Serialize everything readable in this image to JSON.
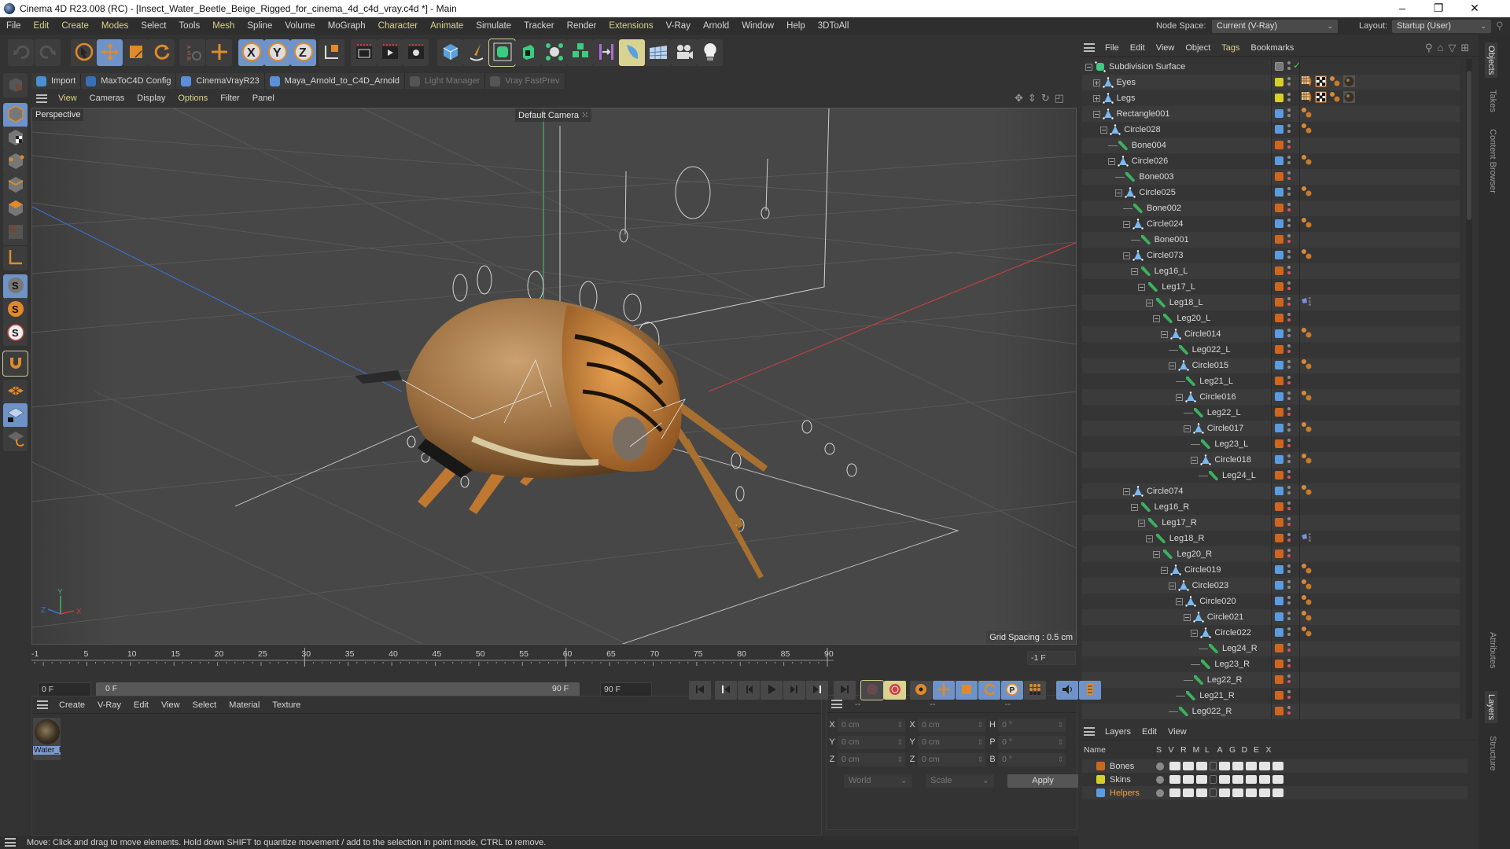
{
  "window": {
    "title": "Cinema 4D R23.008 (RC) - [Insect_Water_Beetle_Beige_Rigged_for_cinema_4d_c4d_vray.c4d *] - Main",
    "controls": [
      "minimize-icon",
      "restore-icon",
      "close-icon"
    ]
  },
  "menubar": {
    "items": [
      "File",
      "Edit",
      "Create",
      "Modes",
      "Select",
      "Tools",
      "Mesh",
      "Spline",
      "Volume",
      "MoGraph",
      "Character",
      "Animate",
      "Simulate",
      "Tracker",
      "Render",
      "Extensions",
      "V-Ray",
      "Arnold",
      "Window",
      "Help",
      "3DToAll"
    ],
    "highlighted": [
      "Edit",
      "Create",
      "Modes",
      "Mesh",
      "Character",
      "Animate",
      "Extensions"
    ],
    "node_space_label": "Node Space:",
    "node_space_value": "Current (V-Ray)",
    "layout_label": "Layout:",
    "layout_value": "Startup (User)"
  },
  "toolbar": {
    "tools": [
      "undo-icon",
      "redo-icon",
      "live-selection-icon",
      "move-icon",
      "scale-icon",
      "rotate-icon",
      "psr-icon",
      "add-transform-icon",
      "x-axis-lock-icon",
      "y-axis-lock-icon",
      "z-axis-lock-icon",
      "coordinate-system-icon",
      "render-view-icon",
      "render-picture-viewer-icon",
      "render-settings-icon",
      "cube-icon",
      "pen-spline-icon",
      "subdivision-surface-icon",
      "extrude-icon",
      "mograph-cloner-icon",
      "array-icon",
      "symmetry-icon",
      "deformer-icon",
      "floor-icon",
      "camera-icon",
      "light-icon"
    ]
  },
  "plugin_bar": {
    "items": [
      {
        "label": "Import",
        "enabled": true
      },
      {
        "label": "MaxToC4D Config",
        "enabled": true
      },
      {
        "label": "CinemaVrayR23",
        "enabled": true
      },
      {
        "label": "Maya_Arnold_to_C4D_Arnold",
        "enabled": true
      },
      {
        "label": "Light Manager",
        "enabled": false
      },
      {
        "label": "Vray FastPrev",
        "enabled": false
      }
    ]
  },
  "left_palette": {
    "tools": [
      "make-editable-icon",
      "model-mode-icon",
      "texture-mode-icon",
      "point-mode-icon",
      "edge-mode-icon",
      "polygon-mode-icon",
      "uv-mode-icon",
      "axis-mode-icon",
      "snap-icon",
      "snap-settings-icon",
      "snap-enable-icon",
      "magnet-icon",
      "workplane-icon",
      "locked-workplane-icon",
      "workplane-align-icon"
    ]
  },
  "viewport": {
    "menu": [
      "View",
      "Cameras",
      "Display",
      "Options",
      "Filter",
      "Panel"
    ],
    "menu_highlighted": [
      "View",
      "Options"
    ],
    "view_name": "Perspective",
    "camera": "Default Camera",
    "grid_spacing": "Grid Spacing : 0.5 cm",
    "nav_icons": [
      "pan-icon",
      "zoom-icon",
      "orbit-icon",
      "maximize-icon"
    ],
    "axis_labels": {
      "x": "X",
      "y": "Y",
      "z": "Z"
    }
  },
  "timeline": {
    "ticks": [
      "-1",
      "5",
      "10",
      "15",
      "20",
      "25",
      "30",
      "35",
      "40",
      "45",
      "50",
      "55",
      "60",
      "65",
      "70",
      "75",
      "80",
      "85",
      "90"
    ],
    "current_frame_field": "0 F",
    "range_start": "0 F",
    "range_end": "90 F",
    "max_frame_field": "90 F",
    "end_frame_field": "-1 F"
  },
  "playback": {
    "buttons": [
      "go-to-start-icon",
      "previous-key-icon",
      "previous-frame-icon",
      "play-icon",
      "next-frame-icon",
      "next-key-icon",
      "go-to-end-icon",
      "record-active-icon",
      "autokey-icon",
      "keyframe-selection-icon",
      "key-position-icon",
      "key-scale-icon",
      "key-rotation-icon",
      "key-parameter-icon",
      "key-pla-icon",
      "sound-icon",
      "timeline-icon"
    ]
  },
  "material_manager": {
    "menu": [
      "Create",
      "V-Ray",
      "Edit",
      "View",
      "Select",
      "Material",
      "Texture"
    ],
    "materials": [
      {
        "label": "Water_B"
      }
    ]
  },
  "coordinates": {
    "header": [
      "--",
      "--",
      "--"
    ],
    "rows": [
      {
        "l1": "X",
        "v1": "0 cm",
        "l2": "X",
        "v2": "0 cm",
        "l3": "H",
        "v3": "0 °"
      },
      {
        "l1": "Y",
        "v1": "0 cm",
        "l2": "Y",
        "v2": "0 cm",
        "l3": "P",
        "v3": "0 °"
      },
      {
        "l1": "Z",
        "v1": "0 cm",
        "l2": "Z",
        "v2": "0 cm",
        "l3": "B",
        "v3": "0 °"
      }
    ],
    "mode_select": "World",
    "transform_select": "Scale",
    "apply_label": "Apply"
  },
  "status": {
    "text": "Move: Click and drag to move elements. Hold down SHIFT to quantize movement / add to the selection in point mode, CTRL to remove."
  },
  "object_manager": {
    "menu": [
      "File",
      "Edit",
      "View",
      "Object",
      "Tags",
      "Bookmarks"
    ],
    "menu_highlighted": [
      "Tags"
    ],
    "tools": [
      "search-icon",
      "home-icon",
      "filter-icon",
      "new-panel-icon"
    ],
    "objects": [
      {
        "name": "Subdivision Surface",
        "depth": 0,
        "type": "subdiv",
        "color": "#777777",
        "expand": "minus",
        "tags": []
      },
      {
        "name": "Eyes",
        "depth": 1,
        "type": "null",
        "color": "#d8d02a",
        "expand": "plus",
        "tags": [
          "texture",
          "uvw",
          "weight",
          "material"
        ]
      },
      {
        "name": "Legs",
        "depth": 1,
        "type": "null",
        "color": "#d8d02a",
        "expand": "plus",
        "tags": [
          "texture",
          "uvw",
          "weight",
          "material"
        ]
      },
      {
        "name": "Rectangle001",
        "depth": 1,
        "type": "null",
        "color": "#5b9be0",
        "expand": "minus",
        "tags": [
          "weight"
        ]
      },
      {
        "name": "Circle028",
        "depth": 2,
        "type": "null",
        "color": "#5b9be0",
        "expand": "minus",
        "tags": [
          "weight"
        ]
      },
      {
        "name": "Bone004",
        "depth": 3,
        "type": "bone",
        "color": "#d0651e",
        "expand": "",
        "tags": []
      },
      {
        "name": "Circle026",
        "depth": 3,
        "type": "null",
        "color": "#5b9be0",
        "expand": "minus",
        "tags": [
          "weight"
        ]
      },
      {
        "name": "Bone003",
        "depth": 4,
        "type": "bone",
        "color": "#d0651e",
        "expand": "",
        "tags": []
      },
      {
        "name": "Circle025",
        "depth": 4,
        "type": "null",
        "color": "#5b9be0",
        "expand": "minus",
        "tags": [
          "weight"
        ]
      },
      {
        "name": "Bone002",
        "depth": 5,
        "type": "bone",
        "color": "#d0651e",
        "expand": "",
        "tags": []
      },
      {
        "name": "Circle024",
        "depth": 5,
        "type": "null",
        "color": "#5b9be0",
        "expand": "minus",
        "tags": [
          "weight"
        ]
      },
      {
        "name": "Bone001",
        "depth": 6,
        "type": "bone",
        "color": "#d0651e",
        "expand": "",
        "tags": []
      },
      {
        "name": "Circle073",
        "depth": 5,
        "type": "null",
        "color": "#5b9be0",
        "expand": "minus",
        "tags": [
          "weight"
        ]
      },
      {
        "name": "Leg16_L",
        "depth": 6,
        "type": "bone",
        "color": "#d0651e",
        "expand": "minus",
        "tags": []
      },
      {
        "name": "Leg17_L",
        "depth": 7,
        "type": "bone",
        "color": "#d0651e",
        "expand": "minus",
        "tags": []
      },
      {
        "name": "Leg18_L",
        "depth": 8,
        "type": "bone",
        "color": "#d0651e",
        "expand": "minus",
        "tags": [
          "ik"
        ]
      },
      {
        "name": "Leg20_L",
        "depth": 9,
        "type": "bone",
        "color": "#d0651e",
        "expand": "minus",
        "tags": []
      },
      {
        "name": "Circle014",
        "depth": 10,
        "type": "null",
        "color": "#5b9be0",
        "expand": "minus",
        "tags": [
          "weight"
        ]
      },
      {
        "name": "Leg022_L",
        "depth": 11,
        "type": "bone",
        "color": "#d0651e",
        "expand": "",
        "tags": []
      },
      {
        "name": "Circle015",
        "depth": 11,
        "type": "null",
        "color": "#5b9be0",
        "expand": "minus",
        "tags": [
          "weight"
        ]
      },
      {
        "name": "Leg21_L",
        "depth": 12,
        "type": "bone",
        "color": "#d0651e",
        "expand": "",
        "tags": []
      },
      {
        "name": "Circle016",
        "depth": 12,
        "type": "null",
        "color": "#5b9be0",
        "expand": "minus",
        "tags": [
          "weight"
        ]
      },
      {
        "name": "Leg22_L",
        "depth": 13,
        "type": "bone",
        "color": "#d0651e",
        "expand": "",
        "tags": []
      },
      {
        "name": "Circle017",
        "depth": 13,
        "type": "null",
        "color": "#5b9be0",
        "expand": "minus",
        "tags": [
          "weight"
        ]
      },
      {
        "name": "Leg23_L",
        "depth": 14,
        "type": "bone",
        "color": "#d0651e",
        "expand": "",
        "tags": []
      },
      {
        "name": "Circle018",
        "depth": 14,
        "type": "null",
        "color": "#5b9be0",
        "expand": "minus",
        "tags": [
          "weight"
        ]
      },
      {
        "name": "Leg24_L",
        "depth": 15,
        "type": "bone",
        "color": "#d0651e",
        "expand": "",
        "tags": []
      },
      {
        "name": "Circle074",
        "depth": 5,
        "type": "null",
        "color": "#5b9be0",
        "expand": "minus",
        "tags": [
          "weight"
        ]
      },
      {
        "name": "Leg16_R",
        "depth": 6,
        "type": "bone",
        "color": "#d0651e",
        "expand": "minus",
        "tags": []
      },
      {
        "name": "Leg17_R",
        "depth": 7,
        "type": "bone",
        "color": "#d0651e",
        "expand": "minus",
        "tags": []
      },
      {
        "name": "Leg18_R",
        "depth": 8,
        "type": "bone",
        "color": "#d0651e",
        "expand": "minus",
        "tags": [
          "ik"
        ]
      },
      {
        "name": "Leg20_R",
        "depth": 9,
        "type": "bone",
        "color": "#d0651e",
        "expand": "minus",
        "tags": []
      },
      {
        "name": "Circle019",
        "depth": 10,
        "type": "null",
        "color": "#5b9be0",
        "expand": "minus",
        "tags": [
          "weight"
        ]
      },
      {
        "name": "Circle023",
        "depth": 11,
        "type": "null",
        "color": "#5b9be0",
        "expand": "minus",
        "tags": [
          "weight"
        ]
      },
      {
        "name": "Circle020",
        "depth": 12,
        "type": "null",
        "color": "#5b9be0",
        "expand": "minus",
        "tags": [
          "weight"
        ]
      },
      {
        "name": "Circle021",
        "depth": 13,
        "type": "null",
        "color": "#5b9be0",
        "expand": "minus",
        "tags": [
          "weight"
        ]
      },
      {
        "name": "Circle022",
        "depth": 14,
        "type": "null",
        "color": "#5b9be0",
        "expand": "minus",
        "tags": [
          "weight"
        ]
      },
      {
        "name": "Leg24_R",
        "depth": 15,
        "type": "bone",
        "color": "#d0651e",
        "expand": "",
        "tags": []
      },
      {
        "name": "Leg23_R",
        "depth": 14,
        "type": "bone",
        "color": "#d0651e",
        "expand": "",
        "tags": []
      },
      {
        "name": "Leg22_R",
        "depth": 13,
        "type": "bone",
        "color": "#d0651e",
        "expand": "",
        "tags": []
      },
      {
        "name": "Leg21_R",
        "depth": 12,
        "type": "bone",
        "color": "#d0651e",
        "expand": "",
        "tags": []
      },
      {
        "name": "Leg022_R",
        "depth": 11,
        "type": "bone",
        "color": "#d0651e",
        "expand": "",
        "tags": []
      }
    ]
  },
  "layer_manager": {
    "menu": [
      "Layers",
      "Edit",
      "View"
    ],
    "columns": [
      "Name",
      "S",
      "V",
      "R",
      "M",
      "L",
      "A",
      "G",
      "D",
      "E",
      "X"
    ],
    "layers": [
      {
        "name": "Bones",
        "color": "#d0651e",
        "selected": false
      },
      {
        "name": "Skins",
        "color": "#d8d02a",
        "selected": false
      },
      {
        "name": "Helpers",
        "color": "#5b9be0",
        "selected": true
      }
    ]
  },
  "side_tabs": {
    "top": [
      "Objects",
      "Takes",
      "Content Browser"
    ],
    "bottom": [
      "Attributes",
      "Layers",
      "Structure"
    ],
    "active_top": "Objects",
    "active_bottom": "Layers"
  },
  "colors": {
    "accent_blue": "#6f93c9",
    "highlight_yellow": "#d9d48a",
    "bone_orange": "#d0651e",
    "helper_blue": "#5b9be0",
    "skin_yellow": "#d8d02a",
    "layer_selected_text": "#f0a040"
  }
}
